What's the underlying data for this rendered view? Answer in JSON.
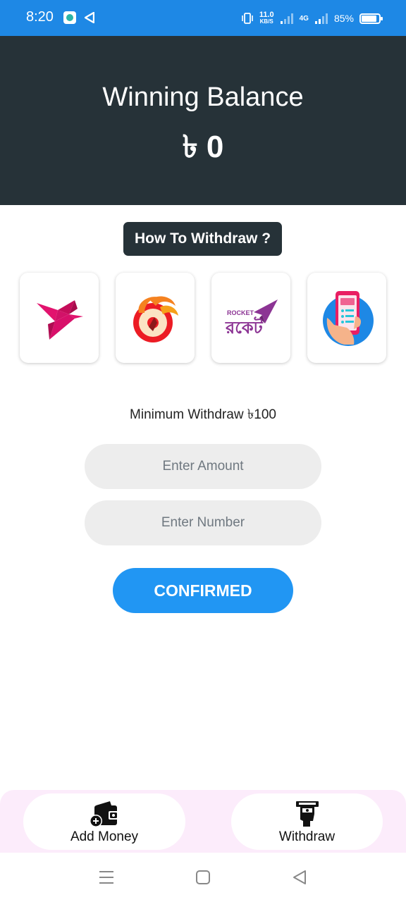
{
  "status_bar": {
    "time": "8:20",
    "speed_value": "11.0",
    "speed_unit": "KB/S",
    "network_label": "4G",
    "battery_percent": "85%"
  },
  "header": {
    "title": "Winning Balance",
    "balance": "৳ 0"
  },
  "how_to_withdraw_label": "How To Withdraw ?",
  "payment_methods": [
    {
      "name": "bkash-icon"
    },
    {
      "name": "nagad-icon"
    },
    {
      "name": "rocket-icon",
      "text": "ROCKET",
      "text_bn": "রকেট"
    },
    {
      "name": "mobile-banking-icon"
    }
  ],
  "minimum_text": "Minimum Withdraw ৳100",
  "amount_input": {
    "placeholder": "Enter Amount",
    "value": ""
  },
  "number_input": {
    "placeholder": "Enter Number",
    "value": ""
  },
  "confirm_label": "CONFIRMED",
  "bottom_tabs": {
    "add_money": "Add Money",
    "withdraw": "Withdraw"
  },
  "colors": {
    "status_bar": "#1e88e5",
    "header_bg": "#263238",
    "confirm_button": "#2196f3",
    "bottom_bar_bg": "#fcecfb"
  }
}
